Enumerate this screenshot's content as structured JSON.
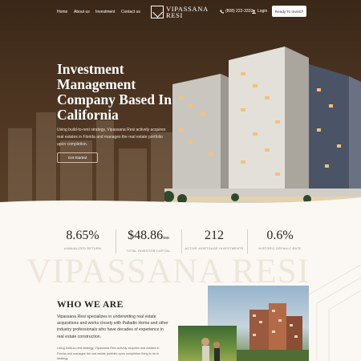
{
  "nav": {
    "links": [
      "Home",
      "About us",
      "Investment",
      "Contact us"
    ],
    "logo_line1": "VIPASSANA",
    "logo_line2": "RESI",
    "phone": "(808) 222-3333",
    "login": "Login",
    "cta": "Ready To Invest?"
  },
  "hero": {
    "title": "Investment Management Company Based In California",
    "description": "Using build-to-rent strategy, Vipassana Resi actively acquires real estates in Florida and manages the real estate portfolio upon completion.",
    "button": "Get Started"
  },
  "stats": [
    {
      "value": "8.65%",
      "label": "ANNUALIZED RETURN"
    },
    {
      "value": "$48.86",
      "unit": "mn",
      "label": "TOTAL INVESTOR CAPITAL"
    },
    {
      "value": "212",
      "label": "ACTIVE MORTGAGE INVESTMENTS"
    },
    {
      "value": "0.6%",
      "label": "HISTORIC DEFAULT RATE"
    }
  ],
  "watermark": "VIPASSANA RESI",
  "who": {
    "title": "WHO WE ARE",
    "paragraph1": "Vipassana Resi specializes in underwriting real estate acquisitions and works closely with Palladio Home and other industry professionals who have decades of experience in real estate construction.",
    "paragraph2": "Using build-to-rent strategy, Vipassana Resi actively acquires real estates in Florida and manages the real estate portfolio upon completion thing to do in strategy."
  },
  "colors": {
    "hero_bg": "#4a3320",
    "page_bg": "#fbf8f3",
    "cta_bg": "#ffffff",
    "text_dark": "#2a2320"
  },
  "icons": {
    "phone": "phone-icon",
    "login": "user-icon",
    "logo": "logo-mark-icon"
  }
}
